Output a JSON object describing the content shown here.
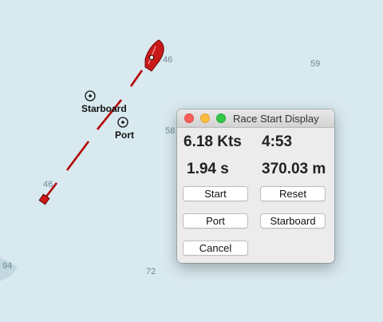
{
  "map": {
    "depth_soundings": [
      "46",
      "59",
      "58",
      "46",
      "94",
      "72"
    ],
    "marks": {
      "starboard_label": "Starboard",
      "port_label": "Port"
    }
  },
  "dialog": {
    "title": "Race Start Display",
    "speed": "6.18 Kts",
    "time": "4:53",
    "seconds": "1.94 s",
    "distance": "370.03 m",
    "buttons": {
      "start": "Start",
      "reset": "Reset",
      "port": "Port",
      "starboard": "Starboard",
      "cancel": "Cancel"
    }
  }
}
